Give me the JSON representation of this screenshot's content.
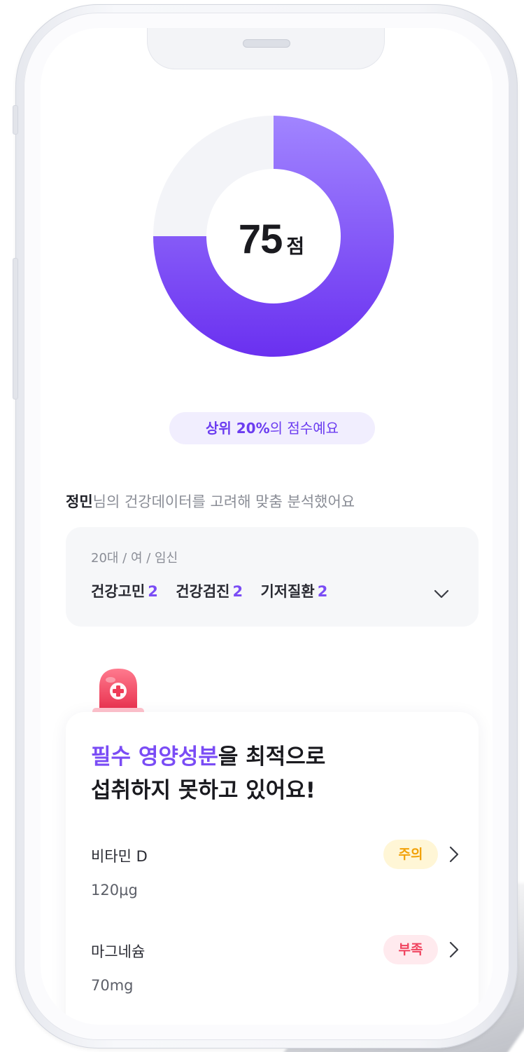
{
  "score": {
    "value": "75",
    "unit": "점",
    "fraction": 0.75
  },
  "rank": {
    "highlight": "상위 20%",
    "tail": "의 점수예요"
  },
  "intro": {
    "name": "정민",
    "text": "님의 건강데이터를 고려해 맞춤 분석했어요"
  },
  "profile": {
    "tags": "20대 / 여  / 임신",
    "stats": [
      {
        "label": "건강고민",
        "count": "2"
      },
      {
        "label": "건강검진",
        "count": "2"
      },
      {
        "label": "기저질환",
        "count": "2"
      }
    ]
  },
  "nutrients": {
    "headline_highlight": "필수 영양성분",
    "headline_rest": "을 최적으로",
    "headline_line2": "섭취하지 못하고 있어요!",
    "items": [
      {
        "name": "비타민 D",
        "amount": "120μg",
        "status": "주의"
      },
      {
        "name": "마그네슘",
        "amount": "70mg",
        "status": "부족"
      }
    ]
  },
  "colors": {
    "accent": "#7a4cf5",
    "donut_start": "#a185ff",
    "donut_end": "#6a30f0",
    "caution": "#f2a20a",
    "lack": "#f0435f"
  },
  "icons": [
    "siren-icon",
    "chevron-down-icon",
    "chevron-right-icon"
  ]
}
